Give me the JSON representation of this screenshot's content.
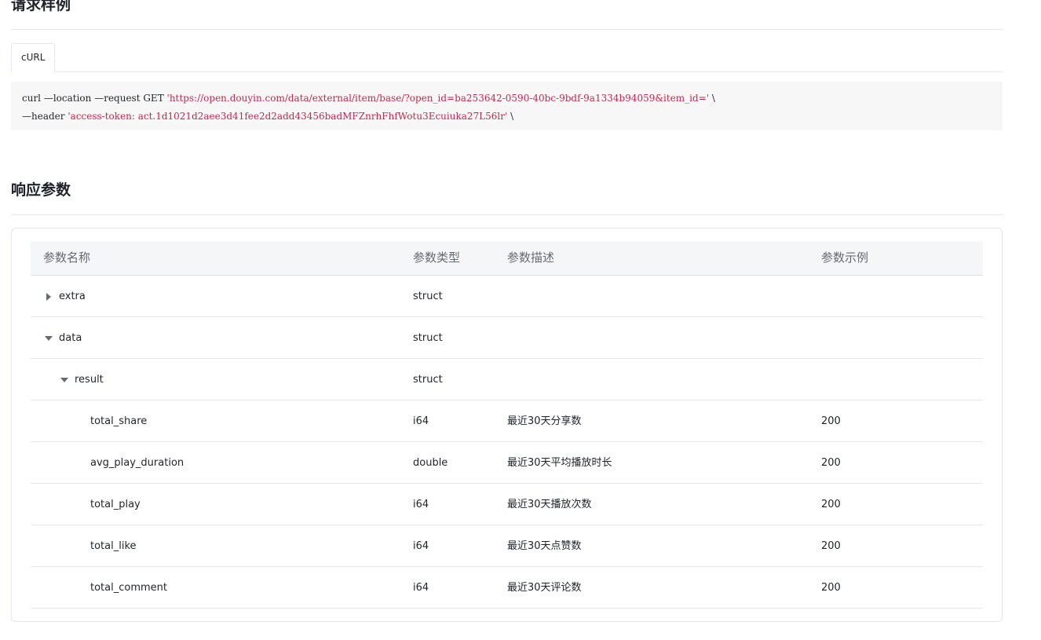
{
  "request_section": {
    "title": "请求样例",
    "tab_label": "cURL",
    "code_line1_prefix": "curl —location —request GET ",
    "code_line1_url": "'https://open.douyin.com/data/external/item/base/?open_id=ba253642-0590-40bc-9bdf-9a1334b94059&item_id='",
    "code_line1_suffix": " \\",
    "code_line2_prefix": "—header ",
    "code_line2_value": "'access-token: act.1d1021d2aee3d41fee2d2add43456badMFZnrhFhfWotu3Ecuiuka27L56lr'",
    "code_line2_suffix": " \\"
  },
  "response_section": {
    "title": "响应参数",
    "headers": {
      "name": "参数名称",
      "type": "参数类型",
      "desc": "参数描述",
      "example": "参数示例"
    },
    "rows": [
      {
        "name": "extra",
        "type": "struct",
        "desc": "",
        "example": "",
        "caret": "right",
        "level": 0
      },
      {
        "name": "data",
        "type": "struct",
        "desc": "",
        "example": "",
        "caret": "down",
        "level": 0
      },
      {
        "name": "result",
        "type": "struct",
        "desc": "",
        "example": "",
        "caret": "down",
        "level": 1
      },
      {
        "name": "total_share",
        "type": "i64",
        "desc": "最近30天分享数",
        "example": "200",
        "caret": "",
        "level": 2
      },
      {
        "name": "avg_play_duration",
        "type": "double",
        "desc": "最近30天平均播放时长",
        "example": "200",
        "caret": "",
        "level": 2
      },
      {
        "name": "total_play",
        "type": "i64",
        "desc": "最近30天播放次数",
        "example": "200",
        "caret": "",
        "level": 2
      },
      {
        "name": "total_like",
        "type": "i64",
        "desc": "最近30天点赞数",
        "example": "200",
        "caret": "",
        "level": 2
      },
      {
        "name": "total_comment",
        "type": "i64",
        "desc": "最近30天评论数",
        "example": "200",
        "caret": "",
        "level": 2
      }
    ]
  }
}
